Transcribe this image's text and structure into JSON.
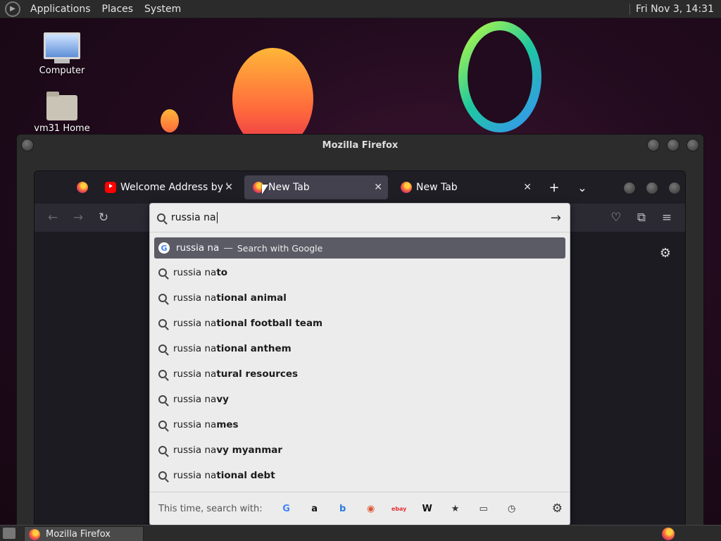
{
  "topbar": {
    "menus": [
      "Applications",
      "Places",
      "System"
    ],
    "clock": "Fri Nov  3, 14:31"
  },
  "desktop": {
    "icons": [
      {
        "label": "Computer"
      },
      {
        "label": "vm31 Home"
      }
    ]
  },
  "window": {
    "title": "Mozilla Firefox"
  },
  "browser": {
    "tabs": [
      {
        "label": "Welcome Address by Vlad",
        "icon": "youtube-icon",
        "close": "✕"
      },
      {
        "label": "New Tab",
        "icon": "firefox-icon",
        "close": "✕",
        "active": true
      },
      {
        "label": "New Tab",
        "icon": "firefox-icon",
        "close": "✕"
      }
    ],
    "new_tab": "+",
    "tab_list": "⌄"
  },
  "urlbar": {
    "value": "russia na",
    "go": "→"
  },
  "suggestions": {
    "heuristic": {
      "typed": "russia na",
      "separator": "—",
      "action": "Search with Google"
    },
    "items": [
      {
        "prefix": "russia na",
        "suffix": "to"
      },
      {
        "prefix": "russia na",
        "suffix": "tional animal"
      },
      {
        "prefix": "russia na",
        "suffix": "tional football team"
      },
      {
        "prefix": "russia na",
        "suffix": "tional anthem"
      },
      {
        "prefix": "russia na",
        "suffix": "tural resources"
      },
      {
        "prefix": "russia na",
        "suffix": "vy"
      },
      {
        "prefix": "russia na",
        "suffix": "mes"
      },
      {
        "prefix": "russia na",
        "suffix": "vy myanmar"
      },
      {
        "prefix": "russia na",
        "suffix": "tional debt"
      }
    ]
  },
  "oneoff": {
    "label": "This time, search with:",
    "engines": [
      {
        "name": "google-icon",
        "glyph": "G",
        "color": "#4285f4"
      },
      {
        "name": "amazon-icon",
        "glyph": "a",
        "color": "#111111"
      },
      {
        "name": "bing-icon",
        "glyph": "b",
        "color": "#2b7bde"
      },
      {
        "name": "duckduckgo-icon",
        "glyph": "◉",
        "color": "#de5833"
      },
      {
        "name": "ebay-icon",
        "glyph": "ebay",
        "color": "#e53238"
      },
      {
        "name": "wikipedia-icon",
        "glyph": "W",
        "color": "#111111"
      },
      {
        "name": "bookmarks-icon",
        "glyph": "★",
        "color": "#333333"
      },
      {
        "name": "tabs-icon",
        "glyph": "▭",
        "color": "#333333"
      },
      {
        "name": "history-icon",
        "glyph": "◷",
        "color": "#333333"
      }
    ]
  },
  "taskbar": {
    "window_label": "Mozilla Firefox"
  }
}
